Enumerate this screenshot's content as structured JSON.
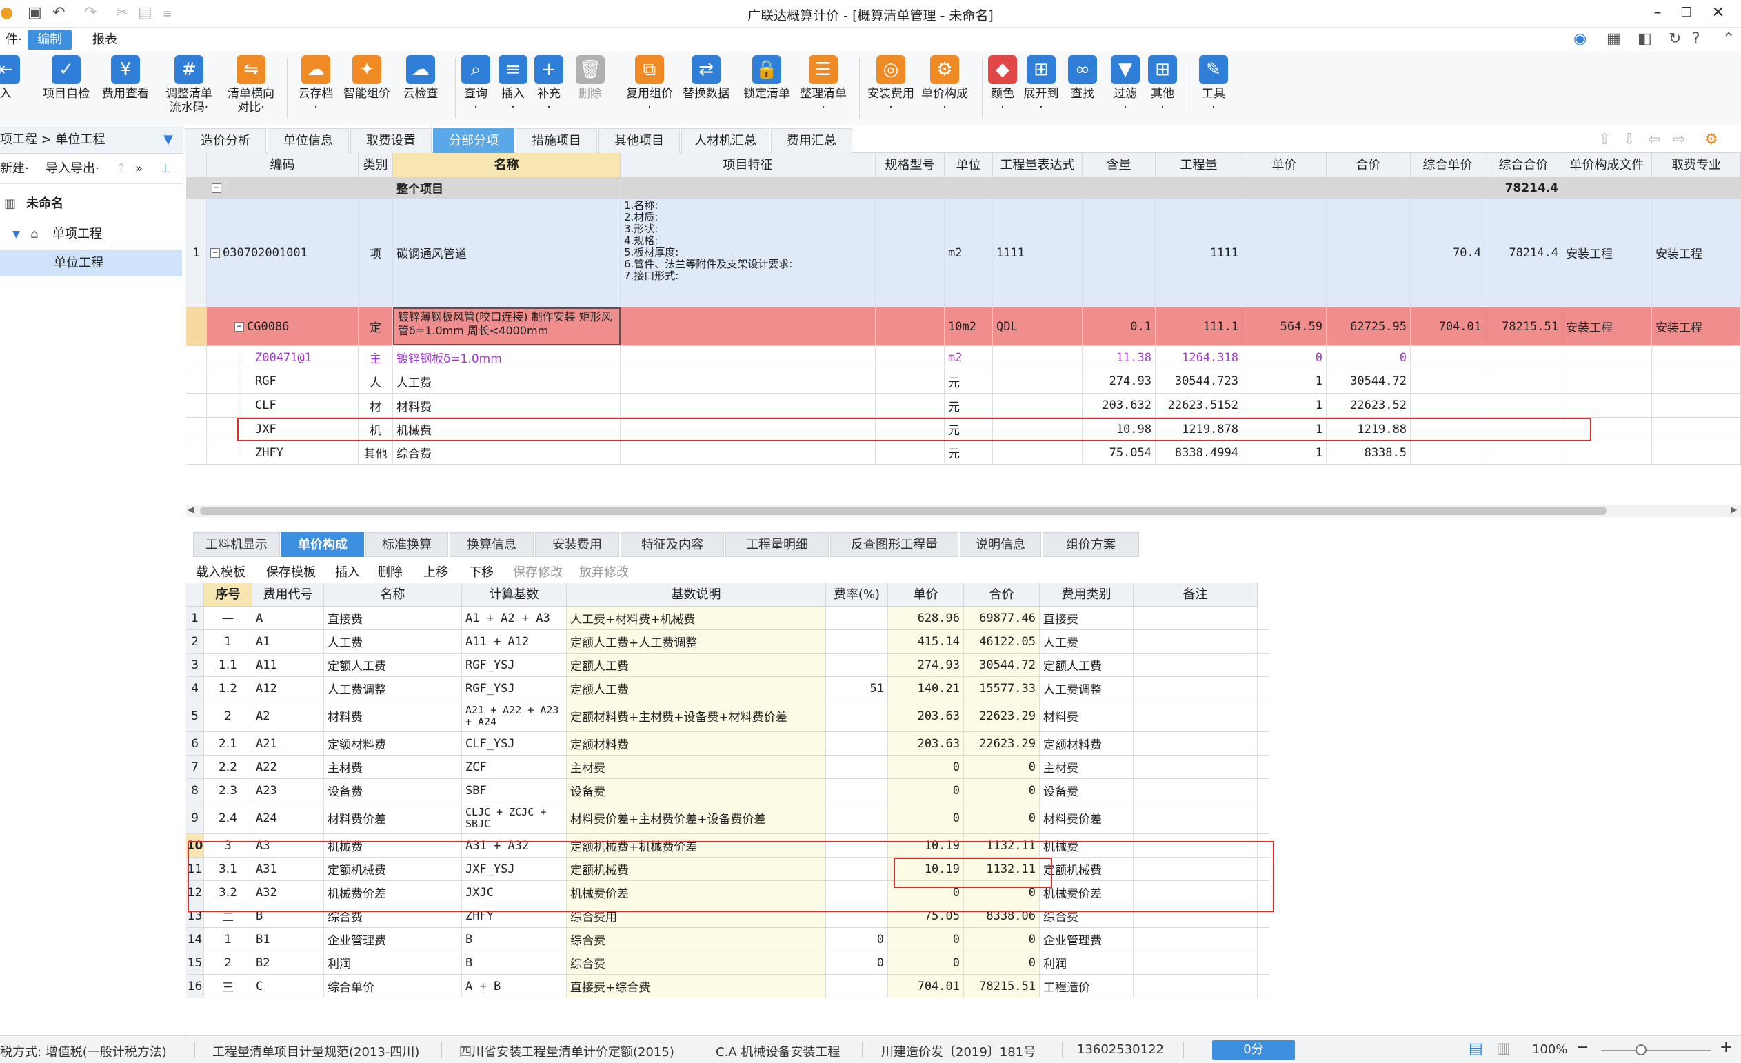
{
  "app": {
    "title": "广联达概算计价 - [概算清单管理 - 未命名]"
  },
  "menu": {
    "items": [
      "件·",
      "编制",
      "报表"
    ],
    "active": "编制"
  },
  "ribbon": {
    "buttons": [
      {
        "label": "入",
        "label2": ""
      },
      {
        "label": "项目自检",
        "label2": ""
      },
      {
        "label": "费用查看",
        "label2": ""
      },
      {
        "label": "调整清单",
        "label2": "流水码·"
      },
      {
        "label": "清单横向",
        "label2": "对比·"
      },
      {
        "label": "云存档",
        "label2": "·"
      },
      {
        "label": "智能组价",
        "label2": ""
      },
      {
        "label": "云检查",
        "label2": ""
      },
      {
        "label": "查询",
        "label2": "·"
      },
      {
        "label": "插入",
        "label2": "·"
      },
      {
        "label": "补充",
        "label2": "·"
      },
      {
        "label": "删除",
        "label2": ""
      },
      {
        "label": "复用组价",
        "label2": "·"
      },
      {
        "label": "替换数据",
        "label2": ""
      },
      {
        "label": "锁定清单",
        "label2": ""
      },
      {
        "label": "整理清单",
        "label2": "·"
      },
      {
        "label": "安装费用",
        "label2": "·"
      },
      {
        "label": "单价构成",
        "label2": "·"
      },
      {
        "label": "颜色",
        "label2": "·"
      },
      {
        "label": "展开到",
        "label2": "·"
      },
      {
        "label": "查找",
        "label2": ""
      },
      {
        "label": "过滤",
        "label2": "·"
      },
      {
        "label": "其他",
        "label2": "·"
      },
      {
        "label": "工具",
        "label2": "·"
      }
    ]
  },
  "left": {
    "crumb": "项工程 > 单位工程",
    "toolbar": {
      "new": "新建·",
      "import_export": "导入导出·",
      "more": "»"
    },
    "tree": [
      {
        "label": "未命名"
      },
      {
        "label": "单项工程"
      },
      {
        "label": "单位工程"
      }
    ]
  },
  "top_tabs": [
    "造价分析",
    "单位信息",
    "取费设置",
    "分部分项",
    "措施项目",
    "其他项目",
    "人材机汇总",
    "费用汇总"
  ],
  "top_tabs_active": "分部分项",
  "main_grid": {
    "headers": [
      "编码",
      "类别",
      "名称",
      "项目特征",
      "规格型号",
      "单位",
      "工程量表达式",
      "含量",
      "工程量",
      "单价",
      "合价",
      "综合单价",
      "综合合价",
      "单价构成文件",
      "取费专业"
    ],
    "whole": {
      "label": "整个项目",
      "total": "78214.4"
    },
    "item": {
      "seq": "1",
      "code": "030702001001",
      "type": "项",
      "name": "碳钢通风管道",
      "features": [
        "1.名称:",
        "2.材质:",
        "3.形状:",
        "4.规格:",
        "5.板材厚度:",
        "6.管件、法兰等附件及支架设计要求:",
        "7.接口形式:"
      ],
      "unit": "m2",
      "expr": "1111",
      "qty": "1111",
      "unit_price_total": "70.4",
      "total": "78214.4",
      "file": "安装工程",
      "major": "安装工程"
    },
    "quota": {
      "code": "CG0086",
      "type": "定",
      "name": "镀锌薄钢板风管(咬口连接) 制作安装 矩形风管δ=1.0mm 周长<4000mm",
      "unit": "10m2",
      "expr": "QDL",
      "content": "0.1",
      "qty": "111.1",
      "price": "564.59",
      "amount": "62725.95",
      "uprice": "704.01",
      "utotal": "78215.51",
      "file": "安装工程",
      "major": "安装工程"
    },
    "subs": [
      {
        "code": "Z00471@1",
        "type": "主",
        "name": "镀锌钢板δ=1.0mm",
        "unit": "m2",
        "content": "11.38",
        "qty": "1264.318",
        "price": "0",
        "amount": "0",
        "purple": true
      },
      {
        "code": "RGF",
        "type": "人",
        "name": "人工费",
        "unit": "元",
        "content": "274.93",
        "qty": "30544.723",
        "price": "1",
        "amount": "30544.72",
        "purple": false
      },
      {
        "code": "CLF",
        "type": "材",
        "name": "材料费",
        "unit": "元",
        "content": "203.632",
        "qty": "22623.5152",
        "price": "1",
        "amount": "22623.52",
        "purple": false
      },
      {
        "code": "JXF",
        "type": "机",
        "name": "机械费",
        "unit": "元",
        "content": "10.98",
        "qty": "1219.878",
        "price": "1",
        "amount": "1219.88",
        "purple": false
      },
      {
        "code": "ZHFY",
        "type": "其他",
        "name": "综合费",
        "unit": "元",
        "content": "75.054",
        "qty": "8338.4994",
        "price": "1",
        "amount": "8338.5",
        "purple": false
      }
    ]
  },
  "bottom_tabs": [
    "工料机显示",
    "单价构成",
    "标准换算",
    "换算信息",
    "安装费用",
    "特征及内容",
    "工程量明细",
    "反查图形工程量",
    "说明信息",
    "组价方案"
  ],
  "bottom_tabs_active": "单价构成",
  "bottom_toolbar": [
    "载入模板",
    "保存模板",
    "插入",
    "删除",
    "上移",
    "下移",
    "保存修改",
    "放弃修改"
  ],
  "bottom_grid": {
    "headers": [
      "序号",
      "费用代号",
      "名称",
      "计算基数",
      "基数说明",
      "费率(%)",
      "单价",
      "合价",
      "费用类别",
      "备注"
    ],
    "rows": [
      {
        "n": "1",
        "seq": "一",
        "code": "A",
        "name": "直接费",
        "base": "A1 + A2 + A3",
        "desc": "人工费+材料费+机械费",
        "rate": "",
        "price": "628.96",
        "amount": "69877.46",
        "cat": "直接费"
      },
      {
        "n": "2",
        "seq": "1",
        "code": "A1",
        "name": "人工费",
        "base": "A11 + A12",
        "desc": "定额人工费+人工费调整",
        "rate": "",
        "price": "415.14",
        "amount": "46122.05",
        "cat": "人工费"
      },
      {
        "n": "3",
        "seq": "1.1",
        "code": "A11",
        "name": "定额人工费",
        "base": "RGF_YSJ",
        "desc": "定额人工费",
        "rate": "",
        "price": "274.93",
        "amount": "30544.72",
        "cat": "定额人工费"
      },
      {
        "n": "4",
        "seq": "1.2",
        "code": "A12",
        "name": "人工费调整",
        "base": "RGF_YSJ",
        "desc": "定额人工费",
        "rate": "51",
        "price": "140.21",
        "amount": "15577.33",
        "cat": "人工费调整"
      },
      {
        "n": "5",
        "seq": "2",
        "code": "A2",
        "name": "材料费",
        "base": "A21 + A22 + A23 + A24",
        "desc": "定额材料费+主材费+设备费+材料费价差",
        "rate": "",
        "price": "203.63",
        "amount": "22623.29",
        "cat": "材料费"
      },
      {
        "n": "6",
        "seq": "2.1",
        "code": "A21",
        "name": "定额材料费",
        "base": "CLF_YSJ",
        "desc": "定额材料费",
        "rate": "",
        "price": "203.63",
        "amount": "22623.29",
        "cat": "定额材料费"
      },
      {
        "n": "7",
        "seq": "2.2",
        "code": "A22",
        "name": "主材费",
        "base": "ZCF",
        "desc": "主材费",
        "rate": "",
        "price": "0",
        "amount": "0",
        "cat": "主材费"
      },
      {
        "n": "8",
        "seq": "2.3",
        "code": "A23",
        "name": "设备费",
        "base": "SBF",
        "desc": "设备费",
        "rate": "",
        "price": "0",
        "amount": "0",
        "cat": "设备费"
      },
      {
        "n": "9",
        "seq": "2.4",
        "code": "A24",
        "name": "材料费价差",
        "base": "CLJC + ZCJC + SBJC",
        "desc": "材料费价差+主材费价差+设备费价差",
        "rate": "",
        "price": "0",
        "amount": "0",
        "cat": "材料费价差"
      },
      {
        "n": "10",
        "seq": "3",
        "code": "A3",
        "name": "机械费",
        "base": "A31 + A32",
        "desc": "定额机械费+机械费价差",
        "rate": "",
        "price": "10.19",
        "amount": "1132.11",
        "cat": "机械费"
      },
      {
        "n": "11",
        "seq": "3.1",
        "code": "A31",
        "name": "定额机械费",
        "base": "JXF_YSJ",
        "desc": "定额机械费",
        "rate": "",
        "price": "10.19",
        "amount": "1132.11",
        "cat": "定额机械费"
      },
      {
        "n": "12",
        "seq": "3.2",
        "code": "A32",
        "name": "机械费价差",
        "base": "JXJC",
        "desc": "机械费价差",
        "rate": "",
        "price": "0",
        "amount": "0",
        "cat": "机械费价差"
      },
      {
        "n": "13",
        "seq": "二",
        "code": "B",
        "name": "综合费",
        "base": "ZHFY",
        "desc": "综合费用",
        "rate": "",
        "price": "75.05",
        "amount": "8338.06",
        "cat": "综合费"
      },
      {
        "n": "14",
        "seq": "1",
        "code": "B1",
        "name": "企业管理费",
        "base": "B",
        "desc": "综合费",
        "rate": "0",
        "price": "0",
        "amount": "0",
        "cat": "企业管理费"
      },
      {
        "n": "15",
        "seq": "2",
        "code": "B2",
        "name": "利润",
        "base": "B",
        "desc": "综合费",
        "rate": "0",
        "price": "0",
        "amount": "0",
        "cat": "利润"
      },
      {
        "n": "16",
        "seq": "三",
        "code": "C",
        "name": "综合单价",
        "base": "A + B",
        "desc": "直接费+综合费",
        "rate": "",
        "price": "704.01",
        "amount": "78215.51",
        "cat": "工程造价"
      }
    ]
  },
  "status": {
    "tax": "税方式: 增值税(一般计税方法)",
    "spec": "工程量清单项目计量规范(2013-四川)",
    "quota_lib": "四川省安装工程量清单计价定额(2015)",
    "major": "C.A 机械设备安装工程",
    "doc": "川建造价发〔2019〕181号",
    "phone": "13602530122",
    "score": "0分",
    "zoom": "100%"
  },
  "colors": {
    "accent": "#3d8fe0",
    "quota_row": "#f08d8d",
    "item_row": "#dfe9f7",
    "highlight_box": "#e02b2b"
  }
}
